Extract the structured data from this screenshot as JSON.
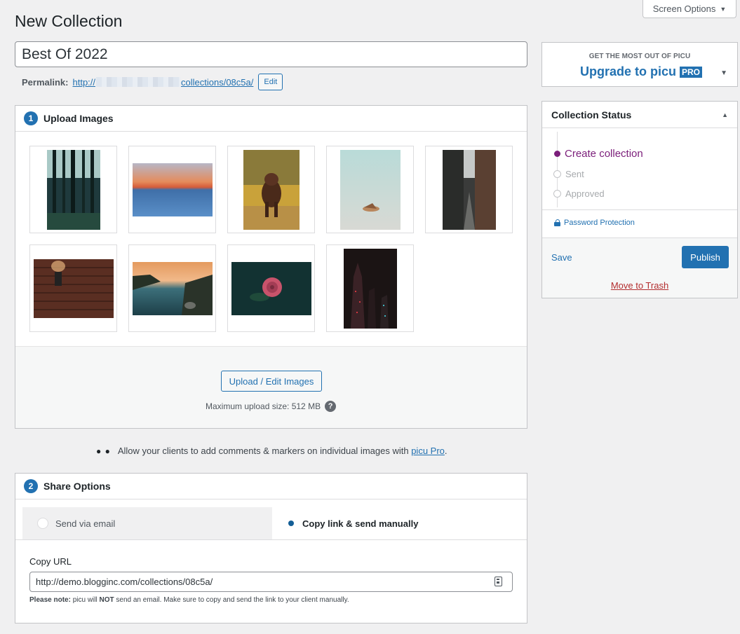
{
  "header": {
    "page_title": "New Collection",
    "screen_options": "Screen Options"
  },
  "title_field": {
    "value": "Best Of 2022"
  },
  "permalink": {
    "label": "Permalink:",
    "url_start": "http://",
    "url_end": "collections/08c5a/",
    "edit_label": "Edit"
  },
  "upload": {
    "step": "1",
    "title": "Upload Images",
    "images": [
      {
        "icon": "forest-image"
      },
      {
        "icon": "sunset-sea-image"
      },
      {
        "icon": "dog-running-image"
      },
      {
        "icon": "bird-flying-image"
      },
      {
        "icon": "alley-image"
      },
      {
        "icon": "brick-wall-lamp-image"
      },
      {
        "icon": "lake-sunset-image"
      },
      {
        "icon": "rose-image"
      },
      {
        "icon": "skyscrapers-night-image"
      }
    ],
    "button_label": "Upload / Edit Images",
    "max_size": "Maximum upload size: 512 MB",
    "help": "?"
  },
  "promo": {
    "text": "Allow your clients to add comments & markers on individual images with",
    "link": "picu Pro",
    "suffix": "."
  },
  "share": {
    "step": "2",
    "title": "Share Options",
    "tab_email": "Send via email",
    "tab_copy": "Copy link & send manually",
    "copy_url_label": "Copy URL",
    "copy_url_value": "http://demo.blogginc.com/collections/08c5a/",
    "note_label": "Please note:",
    "note_text_1": "picu will",
    "note_not": "NOT",
    "note_text_2": "send an email. Make sure to copy and send the link to your client manually."
  },
  "sidebar": {
    "upgrade_small": "GET THE MOST OUT OF PICU",
    "upgrade_big": "Upgrade to picu",
    "pro_badge": "PRO",
    "status_title": "Collection Status",
    "steps": [
      {
        "label": "Create collection",
        "active": true
      },
      {
        "label": "Sent",
        "active": false
      },
      {
        "label": "Approved",
        "active": false
      }
    ],
    "password_protection": "Password Protection",
    "save": "Save",
    "publish": "Publish",
    "trash": "Move to Trash"
  },
  "colors": {
    "accent": "#2271b1",
    "active_step": "#7b1e7a",
    "danger": "#b32d2e"
  }
}
